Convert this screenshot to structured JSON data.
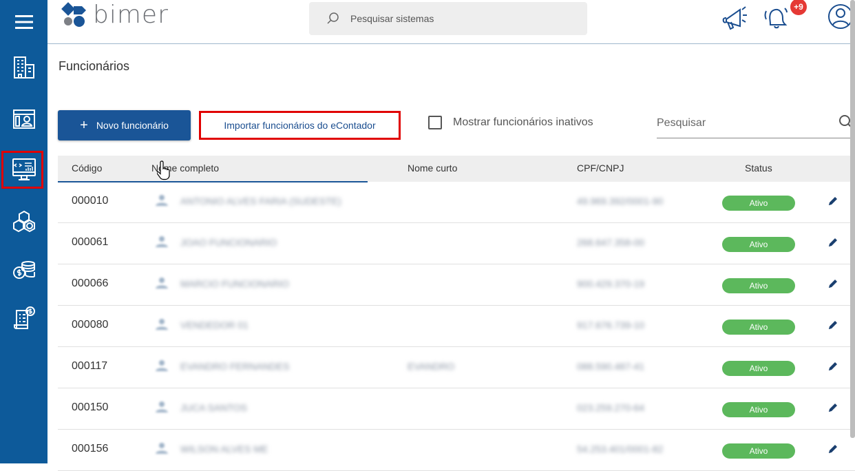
{
  "sidebar": {
    "menu_icon": "hamburger-icon",
    "items": [
      {
        "icon": "buildings-icon"
      },
      {
        "icon": "id-card-icon"
      },
      {
        "icon": "computer-dashboard-icon",
        "active": true
      },
      {
        "icon": "boxes-icon"
      },
      {
        "icon": "coins-icon"
      },
      {
        "icon": "invoice-icon"
      }
    ]
  },
  "header": {
    "logo_text": "bimer",
    "search_placeholder": "Pesquisar sistemas",
    "notifications_badge": "+9"
  },
  "page": {
    "title": "Funcionários",
    "new_button": "Novo funcionário",
    "new_button_icon": "+",
    "import_button": "Importar funcionários do eContador",
    "show_inactive_label": "Mostrar funcionários inativos",
    "filter_placeholder": "Pesquisar"
  },
  "table": {
    "columns": [
      "Código",
      "Nome completo",
      "Nome curto",
      "CPF/CNPJ",
      "Status"
    ],
    "rows": [
      {
        "code": "000010",
        "name": "ANTONIO ALVES FARIA (SUDESTE)",
        "short": "",
        "doc": "49.969.392/0001-90",
        "status": "Ativo"
      },
      {
        "code": "000061",
        "name": "JOAO FUNCIONARIO",
        "short": "",
        "doc": "268.647.358-00",
        "status": "Ativo"
      },
      {
        "code": "000066",
        "name": "MARCIO FUNCIONARIO",
        "short": "",
        "doc": "900.429.370-19",
        "status": "Ativo"
      },
      {
        "code": "000080",
        "name": "VENDEDOR 01",
        "short": "",
        "doc": "917.676.739-10",
        "status": "Ativo"
      },
      {
        "code": "000117",
        "name": "EVANDRO FERNANDES",
        "short": "EVANDRO",
        "doc": "088.590.487-41",
        "status": "Ativo"
      },
      {
        "code": "000150",
        "name": "JUCA SANTOS",
        "short": "",
        "doc": "023.259.270-64",
        "status": "Ativo"
      },
      {
        "code": "000156",
        "name": "WILSON ALVES ME",
        "short": "",
        "doc": "54.253.401/0001-82",
        "status": "Ativo"
      }
    ]
  },
  "colors": {
    "sidebar": "#0d5a9a",
    "primary": "#1a5597",
    "status_active": "#5cb85c",
    "highlight": "#e00000"
  }
}
